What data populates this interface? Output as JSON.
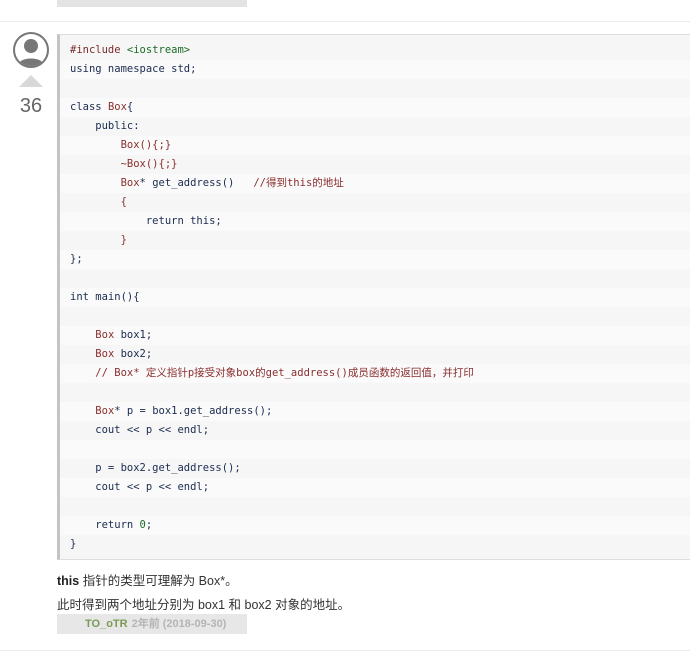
{
  "answer": {
    "votes": "36",
    "code_lines": [
      [
        {
          "t": "#include ",
          "c": "inc"
        },
        {
          "t": "<iostream>",
          "c": "str"
        }
      ],
      [
        {
          "t": "using namespace std;",
          "c": "kw"
        }
      ],
      [],
      [
        {
          "t": "class ",
          "c": "kw"
        },
        {
          "t": "Box",
          "c": "cls"
        },
        {
          "t": "{",
          "c": "kw"
        }
      ],
      [
        {
          "t": "    public:",
          "c": "kw"
        }
      ],
      [
        {
          "t": "        ",
          "c": "kw"
        },
        {
          "t": "Box(){;}",
          "c": "cls"
        }
      ],
      [
        {
          "t": "        ",
          "c": "kw"
        },
        {
          "t": "~Box(){;}",
          "c": "cls"
        }
      ],
      [
        {
          "t": "        ",
          "c": "kw"
        },
        {
          "t": "Box",
          "c": "cls"
        },
        {
          "t": "* get_address()   ",
          "c": "kw"
        },
        {
          "t": "//得到this的地址",
          "c": "cmt"
        }
      ],
      [
        {
          "t": "        {",
          "c": "cls"
        }
      ],
      [
        {
          "t": "            return this;",
          "c": "kw"
        }
      ],
      [
        {
          "t": "        }",
          "c": "cls"
        }
      ],
      [
        {
          "t": "};",
          "c": "kw"
        }
      ],
      [],
      [
        {
          "t": "int main(){",
          "c": "kw"
        }
      ],
      [],
      [
        {
          "t": "    ",
          "c": "kw"
        },
        {
          "t": "Box",
          "c": "cls"
        },
        {
          "t": " box1;",
          "c": "kw"
        }
      ],
      [
        {
          "t": "    ",
          "c": "kw"
        },
        {
          "t": "Box",
          "c": "cls"
        },
        {
          "t": " box2;",
          "c": "kw"
        }
      ],
      [
        {
          "t": "    // Box* 定义指针p接受对象box的get_address()成员函数的返回值，并打印",
          "c": "cmt"
        }
      ],
      [],
      [
        {
          "t": "    ",
          "c": "kw"
        },
        {
          "t": "Box",
          "c": "cls"
        },
        {
          "t": "* p = box1.get_address();",
          "c": "kw"
        }
      ],
      [
        {
          "t": "    cout << p << endl;",
          "c": "kw"
        }
      ],
      [],
      [
        {
          "t": "    p = box2.get_address();",
          "c": "kw"
        }
      ],
      [
        {
          "t": "    cout << p << endl;",
          "c": "kw"
        }
      ],
      [],
      [
        {
          "t": "    return ",
          "c": "kw"
        },
        {
          "t": "0",
          "c": "num"
        },
        {
          "t": ";",
          "c": "kw"
        }
      ],
      [
        {
          "t": "}",
          "c": "kw"
        }
      ]
    ],
    "desc1_bold": "this",
    "desc1_rest": " 指针的类型可理解为 Box*。",
    "desc2": "此时得到两个地址分别为 box1 和 box2 对象的地址。",
    "author": "TO_oTR",
    "time": "2年前 (2018-09-30)"
  }
}
